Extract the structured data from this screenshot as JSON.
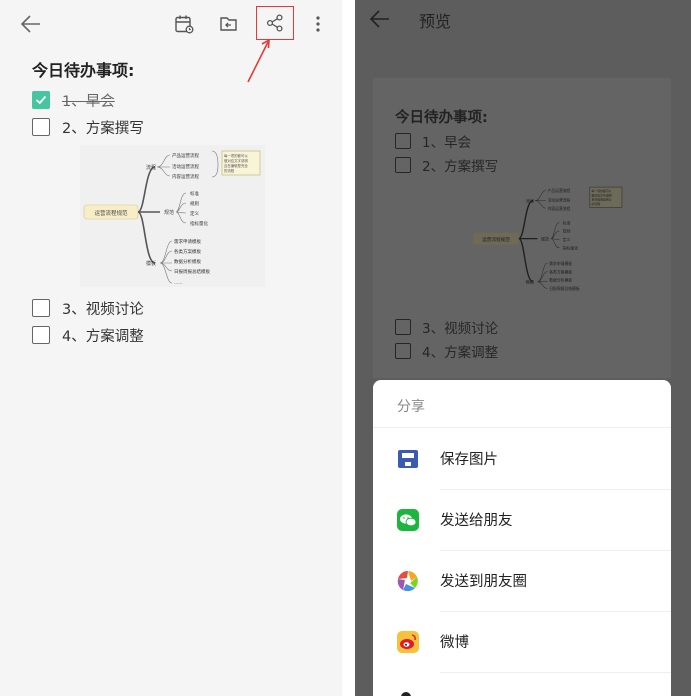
{
  "left": {
    "note_title": "今日待办事项:",
    "todos": [
      {
        "label": "1、早会",
        "checked": true
      },
      {
        "label": "2、方案撰写",
        "checked": false
      },
      {
        "label": "3、视频讨论",
        "checked": false
      },
      {
        "label": "4、方案调整",
        "checked": false
      }
    ],
    "toolbar_icons": [
      "back-arrow-icon",
      "calendar-icon",
      "folder-icon",
      "share-icon",
      "more-icon"
    ],
    "share_highlight_color": "#e53935",
    "check_color": "#46c5a0"
  },
  "mindmap": {
    "center": "运营流程规范",
    "branches": [
      {
        "label": "流程",
        "children": [
          "产品运营流程",
          "活动运营流程",
          "内容运营流程"
        ]
      },
      {
        "label": "规范",
        "children": [
          "标准",
          "规则",
          "定义",
          "指标量化"
        ]
      },
      {
        "label": "模板",
        "children": [
          "需求申请模板",
          "各类方案模板",
          "数据分析模板",
          "日报周报总结模板",
          "......"
        ]
      }
    ],
    "note": [
      "每一项的都可以",
      "做对应文字说明",
      "且在编辑是完全",
      "的流程"
    ]
  },
  "right": {
    "title": "预览",
    "note_title": "今日待办事项:",
    "todos": [
      "1、早会",
      "2、方案撰写",
      "3、视频讨论",
      "4、方案调整"
    ],
    "share_sheet": {
      "title": "分享",
      "items": [
        {
          "label": "保存图片",
          "icon": "save-image-icon"
        },
        {
          "label": "发送给朋友",
          "icon": "wechat-icon"
        },
        {
          "label": "发送到朋友圈",
          "icon": "moments-icon"
        },
        {
          "label": "微博",
          "icon": "weibo-icon"
        }
      ]
    }
  }
}
